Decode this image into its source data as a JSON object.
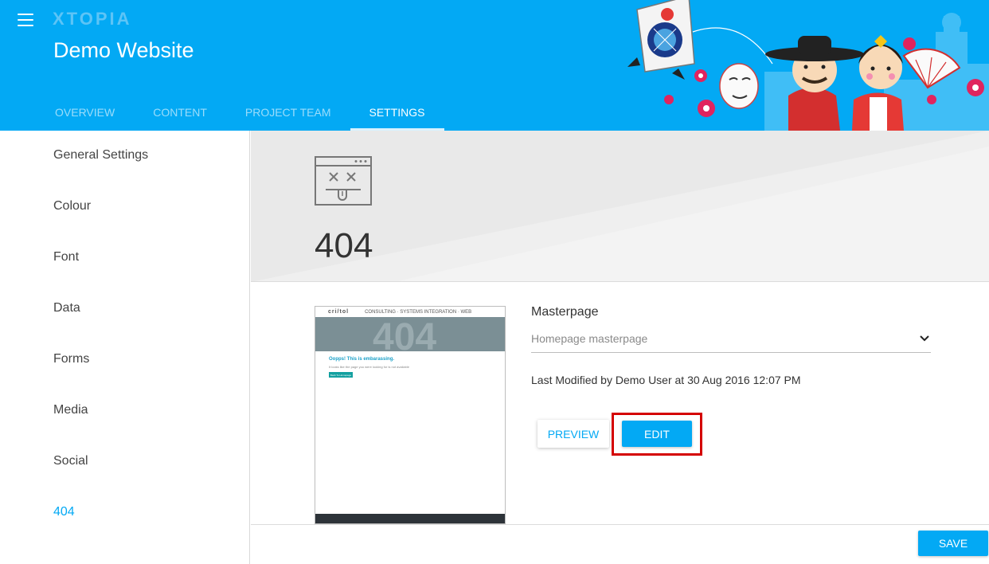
{
  "header": {
    "logo": "XTOPIA",
    "site_title": "Demo Website",
    "tabs": [
      {
        "label": "OVERVIEW"
      },
      {
        "label": "CONTENT"
      },
      {
        "label": "PROJECT TEAM"
      },
      {
        "label": "SETTINGS",
        "active": true
      }
    ]
  },
  "sidebar": {
    "items": [
      {
        "label": "General Settings"
      },
      {
        "label": "Colour"
      },
      {
        "label": "Font"
      },
      {
        "label": "Data"
      },
      {
        "label": "Forms"
      },
      {
        "label": "Media"
      },
      {
        "label": "Social"
      },
      {
        "label": "404",
        "active": true
      }
    ]
  },
  "main": {
    "heading": "404",
    "thumbnail": {
      "brand": "cri/tol",
      "nav": "CONSULTING · SYSTEMS INTEGRATION · WEB",
      "big": "404",
      "message": "Oopps! This is embarassing.",
      "sub": "It looks like the page you were looking for is not available",
      "button": "Back To Homepage"
    },
    "masterpage_label": "Masterpage",
    "masterpage_value": "Homepage masterpage",
    "last_modified": "Last Modified by Demo User at 30 Aug 2016 12:07 PM",
    "preview_label": "PREVIEW",
    "edit_label": "EDIT"
  },
  "footer": {
    "save_label": "SAVE"
  },
  "colors": {
    "primary": "#03a9f4",
    "highlight": "#d40000",
    "banner": "#e9e9e9"
  }
}
